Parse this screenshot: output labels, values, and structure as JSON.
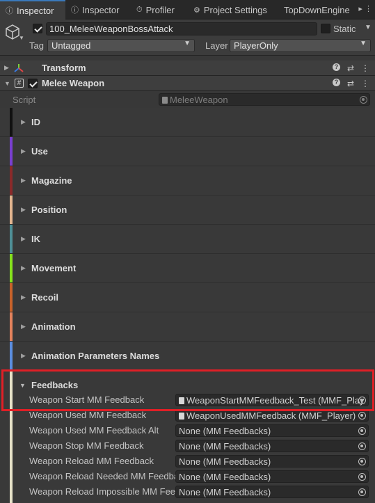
{
  "tabs": [
    {
      "label": "Inspector",
      "icon": "info-icon",
      "active": true
    },
    {
      "label": "Inspector",
      "icon": "info-icon",
      "active": false
    },
    {
      "label": "Profiler",
      "icon": "stopwatch-icon",
      "active": false
    },
    {
      "label": "Project Settings",
      "icon": "gear-icon",
      "active": false
    },
    {
      "label": "TopDownEngine",
      "icon": "",
      "active": false
    }
  ],
  "tab_overflow": "▸ ⋮",
  "object": {
    "name": "100_MeleeWeaponBossAttack",
    "active": true,
    "static_label": "Static",
    "static_checked": false,
    "tag_label": "Tag",
    "tag_value": "Untagged",
    "layer_label": "Layer",
    "layer_value": "PlayerOnly"
  },
  "components": [
    {
      "title": "Transform",
      "expanded": false,
      "icon": "transform-icon"
    },
    {
      "title": "Melee Weapon",
      "expanded": true,
      "icon": "script-icon",
      "enabled": true
    }
  ],
  "script": {
    "label": "Script",
    "value": "MeleeWeapon"
  },
  "sections": [
    {
      "title": "ID",
      "color": "#111111"
    },
    {
      "title": "Use",
      "color": "#7a3fd0"
    },
    {
      "title": "Magazine",
      "color": "#8a2a2a"
    },
    {
      "title": "Position",
      "color": "#e3b58f"
    },
    {
      "title": "IK",
      "color": "#4f8f96"
    },
    {
      "title": "Movement",
      "color": "#86e21c"
    },
    {
      "title": "Recoil",
      "color": "#c8622a"
    },
    {
      "title": "Animation",
      "color": "#e4825c"
    },
    {
      "title": "Animation Parameters Names",
      "color": "#5b8ee0"
    }
  ],
  "feedbacks": {
    "title": "Feedbacks",
    "rows": [
      {
        "label": "Weapon Start MM Feedback",
        "value": "WeaponStartMMFeedback_Test (MMF_Play",
        "has_asset": true
      },
      {
        "label": "Weapon Used MM Feedback",
        "value": "WeaponUsedMMFeedback (MMF_Player)",
        "has_asset": true
      },
      {
        "label": "Weapon Used MM Feedback Alt",
        "value": "None (MM Feedbacks)",
        "has_asset": false
      },
      {
        "label": "Weapon Stop MM Feedback",
        "value": "None (MM Feedbacks)",
        "has_asset": false
      },
      {
        "label": "Weapon Reload MM Feedback",
        "value": "None (MM Feedbacks)",
        "has_asset": false
      },
      {
        "label": "Weapon Reload Needed MM Feedback",
        "value": "None (MM Feedbacks)",
        "has_asset": false
      },
      {
        "label": "Weapon Reload Impossible MM Feedback",
        "value": "None (MM Feedbacks)",
        "has_asset": false
      }
    ]
  },
  "colors": {
    "highlight": "#e01f26",
    "accent": "#3a79bb",
    "feedbacks_bar": "#e6e2c8"
  }
}
